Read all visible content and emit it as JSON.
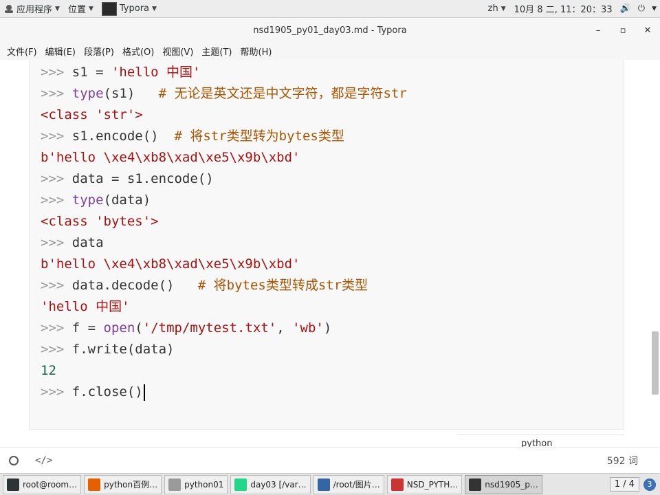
{
  "top_panel": {
    "apps_label": "应用程序",
    "places_label": "位置",
    "active_app": "Typora",
    "input_method": "zh",
    "clock": "10月  8 二, 11：20：33"
  },
  "window": {
    "title": "nsd1905_py01_day03.md - Typora"
  },
  "menu": {
    "file": "文件(F)",
    "edit": "编辑(E)",
    "paragraph": "段落(P)",
    "format": "格式(O)",
    "view": "视图(V)",
    "theme": "主题(T)",
    "help": "帮助(H)"
  },
  "code": {
    "language": "python",
    "lines": [
      {
        "prompt": ">>> ",
        "t": [
          {
            "c": "",
            "v": "s1 = "
          },
          {
            "c": "str",
            "v": "'hello 中国'"
          }
        ]
      },
      {
        "prompt": ">>> ",
        "t": [
          {
            "c": "kw",
            "v": "type"
          },
          {
            "c": "",
            "v": "(s1)   "
          },
          {
            "c": "cm",
            "v": "# 无论是英文还是中文字符，都是字符str"
          }
        ]
      },
      {
        "prompt": "",
        "t": [
          {
            "c": "str",
            "v": "<class 'str'>"
          }
        ]
      },
      {
        "prompt": ">>> ",
        "t": [
          {
            "c": "",
            "v": "s1.encode()  "
          },
          {
            "c": "cm",
            "v": "# 将str类型转为bytes类型"
          }
        ]
      },
      {
        "prompt": "",
        "t": [
          {
            "c": "str",
            "v": "b'hello \\xe4\\xb8\\xad\\xe5\\x9b\\xbd'"
          }
        ]
      },
      {
        "prompt": ">>> ",
        "t": [
          {
            "c": "",
            "v": "data = s1.encode()"
          }
        ]
      },
      {
        "prompt": ">>> ",
        "t": [
          {
            "c": "kw",
            "v": "type"
          },
          {
            "c": "",
            "v": "(data)"
          }
        ]
      },
      {
        "prompt": "",
        "t": [
          {
            "c": "str",
            "v": "<class 'bytes'>"
          }
        ]
      },
      {
        "prompt": ">>> ",
        "t": [
          {
            "c": "",
            "v": "data"
          }
        ]
      },
      {
        "prompt": "",
        "t": [
          {
            "c": "str",
            "v": "b'hello \\xe4\\xb8\\xad\\xe5\\x9b\\xbd'"
          }
        ]
      },
      {
        "prompt": ">>> ",
        "t": [
          {
            "c": "",
            "v": "data.decode()   "
          },
          {
            "c": "cm",
            "v": "# 将bytes类型转成str类型"
          }
        ]
      },
      {
        "prompt": "",
        "t": [
          {
            "c": "str",
            "v": "'hello 中国'"
          }
        ]
      },
      {
        "prompt": ">>> ",
        "t": [
          {
            "c": "",
            "v": "f = "
          },
          {
            "c": "kw",
            "v": "open"
          },
          {
            "c": "",
            "v": "("
          },
          {
            "c": "str",
            "v": "'/tmp/mytest.txt'"
          },
          {
            "c": "",
            "v": ", "
          },
          {
            "c": "str",
            "v": "'wb'"
          },
          {
            "c": "",
            "v": ")"
          }
        ]
      },
      {
        "prompt": ">>> ",
        "t": [
          {
            "c": "",
            "v": "f.write(data)"
          }
        ]
      },
      {
        "prompt": "",
        "t": [
          {
            "c": "num",
            "v": "12"
          }
        ]
      },
      {
        "prompt": ">>> ",
        "t": [
          {
            "c": "",
            "v": "f.close()"
          }
        ],
        "cursor": true
      }
    ]
  },
  "footer": {
    "source_toggle": "</>",
    "word_count": "592 词"
  },
  "taskbar": {
    "tasks": [
      {
        "label": "root@room…",
        "icon": "terminal-icon",
        "color": "#2e3436"
      },
      {
        "label": "python百例…",
        "icon": "firefox-icon",
        "color": "#e66000"
      },
      {
        "label": "python01",
        "icon": "document-icon",
        "color": "#9a9a9a"
      },
      {
        "label": "day03 [/var…",
        "icon": "pycharm-icon",
        "color": "#21d789"
      },
      {
        "label": "/root/图片…",
        "icon": "folder-icon",
        "color": "#3465a4"
      },
      {
        "label": "NSD_PYTH…",
        "icon": "document-icon",
        "color": "#c33"
      },
      {
        "label": "nsd1905_p…",
        "icon": "typora-icon",
        "color": "#333333",
        "active": true
      }
    ],
    "pager": "1 / 4",
    "badge": "3"
  }
}
